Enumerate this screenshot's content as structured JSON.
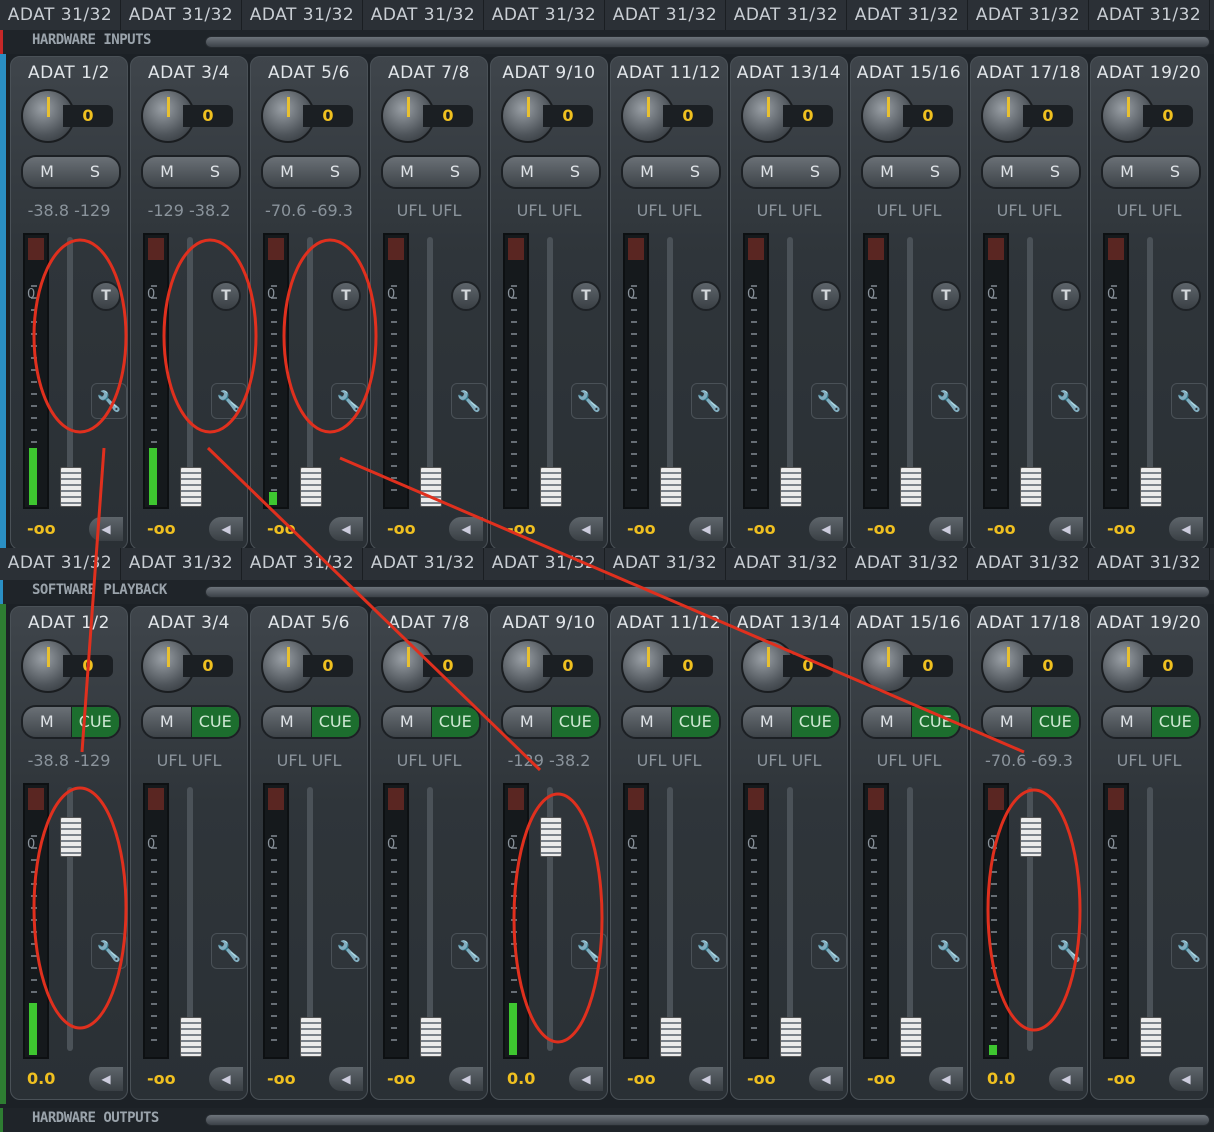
{
  "top_labels": [
    "ADAT 31/32",
    "ADAT 31/32",
    "ADAT 31/32",
    "ADAT 31/32",
    "ADAT 31/32",
    "ADAT 31/32",
    "ADAT 31/32",
    "ADAT 31/32",
    "ADAT 31/32",
    "ADAT 31/32"
  ],
  "mid_labels": [
    "ADAT 31/32",
    "ADAT 31/32",
    "ADAT 31/32",
    "ADAT 31/32",
    "ADAT 31/32",
    "ADAT 31/32",
    "ADAT 31/32",
    "ADAT 31/32",
    "ADAT 31/32",
    "ADAT 31/32"
  ],
  "sections": {
    "hardware_inputs": "HARDWARE INPUTS",
    "software_playback": "SOFTWARE PLAYBACK",
    "hardware_outputs": "HARDWARE OUTPUTS"
  },
  "colors": {
    "inputs_accent": "#c62828",
    "playback_accent": "#2e7d32",
    "meter_green": "#3ec630",
    "value_yellow": "#f0c020",
    "annotation_red": "#e0301e"
  },
  "icons": {
    "trim": "T",
    "settings": "wrench-icon",
    "pan": "arrow-left-icon"
  },
  "hardware_inputs": [
    {
      "name": "ADAT 1/2",
      "gain": "0",
      "left": "-38.8",
      "right": "-129",
      "volume": "-oo",
      "meter": 0.22
    },
    {
      "name": "ADAT 3/4",
      "gain": "0",
      "left": "-129",
      "right": "-38.2",
      "volume": "-oo",
      "meter": 0.22
    },
    {
      "name": "ADAT 5/6",
      "gain": "0",
      "left": "-70.6",
      "right": "-69.3",
      "volume": "-oo",
      "meter": 0.05
    },
    {
      "name": "ADAT 7/8",
      "gain": "0",
      "left": "UFL",
      "right": "UFL",
      "volume": "-oo",
      "meter": 0
    },
    {
      "name": "ADAT 9/10",
      "gain": "0",
      "left": "UFL",
      "right": "UFL",
      "volume": "-oo",
      "meter": 0
    },
    {
      "name": "ADAT 11/12",
      "gain": "0",
      "left": "UFL",
      "right": "UFL",
      "volume": "-oo",
      "meter": 0
    },
    {
      "name": "ADAT 13/14",
      "gain": "0",
      "left": "UFL",
      "right": "UFL",
      "volume": "-oo",
      "meter": 0
    },
    {
      "name": "ADAT 15/16",
      "gain": "0",
      "left": "UFL",
      "right": "UFL",
      "volume": "-oo",
      "meter": 0
    },
    {
      "name": "ADAT 17/18",
      "gain": "0",
      "left": "UFL",
      "right": "UFL",
      "volume": "-oo",
      "meter": 0
    },
    {
      "name": "ADAT 19/20",
      "gain": "0",
      "left": "UFL",
      "right": "UFL",
      "volume": "-oo",
      "meter": 0
    }
  ],
  "software_playback": [
    {
      "name": "ADAT 1/2",
      "gain": "0",
      "left": "-38.8",
      "right": "-129",
      "volume": "0.0",
      "meter": 0.2,
      "fader_up": true
    },
    {
      "name": "ADAT 3/4",
      "gain": "0",
      "left": "UFL",
      "right": "UFL",
      "volume": "-oo",
      "meter": 0,
      "fader_up": false
    },
    {
      "name": "ADAT 5/6",
      "gain": "0",
      "left": "UFL",
      "right": "UFL",
      "volume": "-oo",
      "meter": 0,
      "fader_up": false
    },
    {
      "name": "ADAT 7/8",
      "gain": "0",
      "left": "UFL",
      "right": "UFL",
      "volume": "-oo",
      "meter": 0,
      "fader_up": false
    },
    {
      "name": "ADAT 9/10",
      "gain": "0",
      "left": "-129",
      "right": "-38.2",
      "volume": "0.0",
      "meter": 0.2,
      "fader_up": true
    },
    {
      "name": "ADAT 11/12",
      "gain": "0",
      "left": "UFL",
      "right": "UFL",
      "volume": "-oo",
      "meter": 0,
      "fader_up": false
    },
    {
      "name": "ADAT 13/14",
      "gain": "0",
      "left": "UFL",
      "right": "UFL",
      "volume": "-oo",
      "meter": 0,
      "fader_up": false
    },
    {
      "name": "ADAT 15/16",
      "gain": "0",
      "left": "UFL",
      "right": "UFL",
      "volume": "-oo",
      "meter": 0,
      "fader_up": false
    },
    {
      "name": "ADAT 17/18",
      "gain": "0",
      "left": "-70.6",
      "right": "-69.3",
      "volume": "0.0",
      "meter": 0.04,
      "fader_up": true
    },
    {
      "name": "ADAT 19/20",
      "gain": "0",
      "left": "UFL",
      "right": "UFL",
      "volume": "-oo",
      "meter": 0,
      "fader_up": false
    }
  ],
  "ms_labels": {
    "mute": "M",
    "solo": "S",
    "cue": "CUE"
  },
  "zero_mark": "0"
}
